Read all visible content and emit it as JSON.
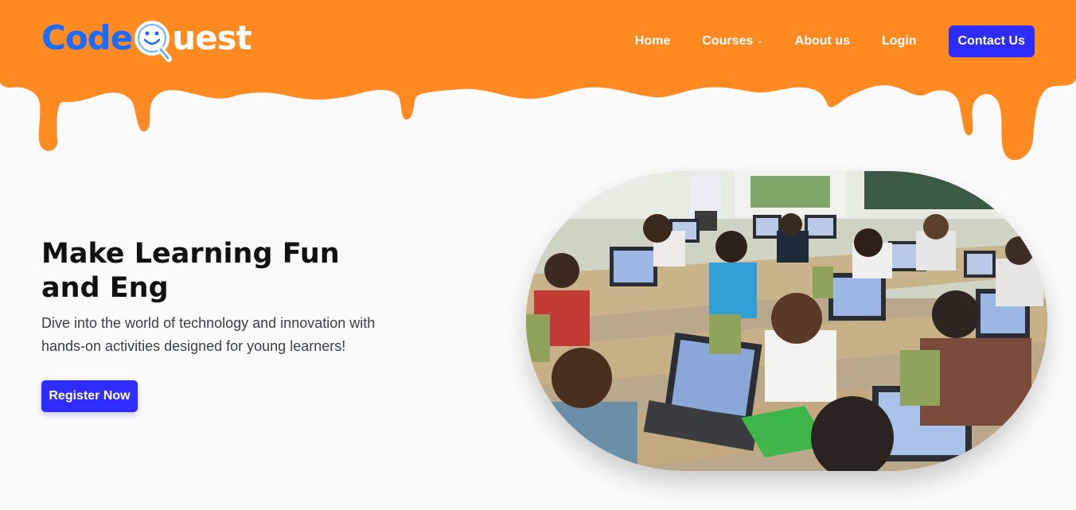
{
  "brand": {
    "logo_prefix": "Code",
    "logo_suffix": "uest",
    "colors": {
      "header": "#ff8a22",
      "logo_blue": "#1a6bff",
      "button": "#2f2cff"
    }
  },
  "nav": {
    "items": [
      {
        "label": "Home"
      },
      {
        "label": "Courses",
        "icon": "chevron-down-icon"
      },
      {
        "label": "About us"
      },
      {
        "label": "Login"
      }
    ],
    "contact_label": "Contact Us"
  },
  "hero": {
    "title": "Make Learning Fun and Eng",
    "description": "Dive into the world of technology and innovation with hands-on activities designed for young learners!",
    "cta_label": "Register Now",
    "image_icon": "classroom-photo"
  }
}
